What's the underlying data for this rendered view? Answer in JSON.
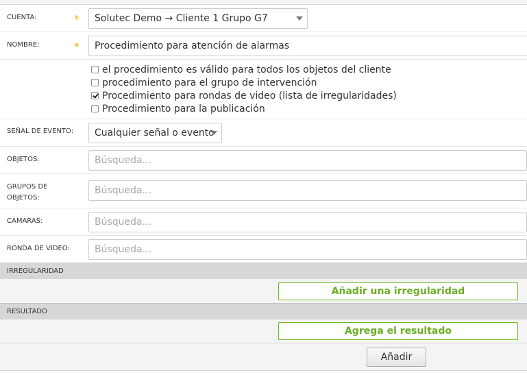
{
  "form": {
    "cuenta": {
      "label": "CUENTA:",
      "required": "*",
      "value": "Solutec Demo → Cliente 1 Grupo G7"
    },
    "nombre": {
      "label": "NOMBRE:",
      "required": "*",
      "value": "Procedimiento para atención de alarmas"
    },
    "checkboxes": [
      {
        "label": "el procedimiento es válido para todos los objetos del cliente",
        "checked": false
      },
      {
        "label": "procedimiento para el grupo de intervención",
        "checked": false
      },
      {
        "label": "Procedimiento para rondas de video (lista de irregularidades)",
        "checked": true
      },
      {
        "label": "Procedimiento para la publicación",
        "checked": false
      }
    ],
    "senal": {
      "label": "SEÑAL DE EVENTO:",
      "value": "Cualquier señal o evento"
    },
    "objetos": {
      "label": "OBJETOS:",
      "placeholder": "Búsqueda..."
    },
    "grupos": {
      "label_line1": "GRUPOS DE",
      "label_line2": "OBJETOS:",
      "placeholder": "Búsqueda..."
    },
    "camaras": {
      "label": "CÁMARAS:",
      "placeholder": "Búsqueda..."
    },
    "ronda": {
      "label": "RONDA DE VIDEO:",
      "placeholder": "Búsqueda..."
    }
  },
  "irregularidad": {
    "title": "IRREGULARIDAD",
    "button": "Añadir una irregularidad"
  },
  "resultado": {
    "title": "RESULTADO",
    "button": "Agrega el resultado"
  },
  "footer": {
    "add_button": "Añadir"
  }
}
